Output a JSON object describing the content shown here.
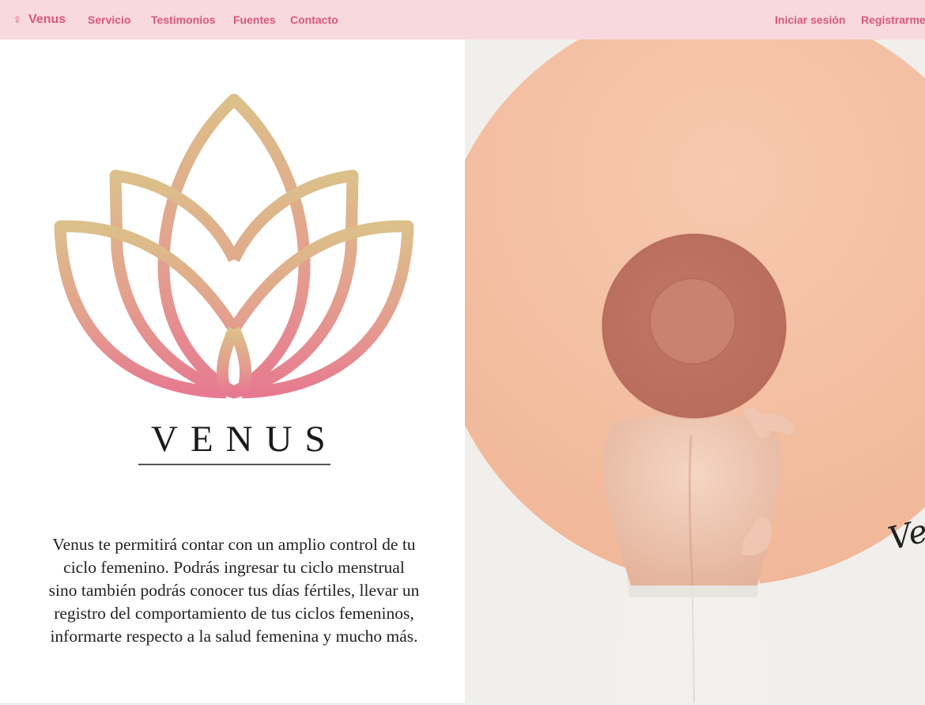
{
  "navbar": {
    "brand_icon": "♀",
    "brand_label": "Venus",
    "links": [
      {
        "label": "Servicio"
      },
      {
        "label": "Testimonios"
      },
      {
        "label": "Fuentes"
      },
      {
        "label": "Contacto"
      }
    ],
    "login_label": "Iniciar sesión",
    "register_label": "Registrarme"
  },
  "hero": {
    "logo_wordmark": "VENUS",
    "description": "Venus te permitirá contar con un amplio control de tu ciclo femenino. Podrás ingresar tu ciclo menstrual sino también podrás conocer tus días fértiles, llevar un registro del comportamiento de tus ciclos femeninos, informarte respecto a la salud femenina y mucho más.",
    "photo_signature": "Ve"
  },
  "colors": {
    "navbar_bg": "#f8d9dd",
    "accent": "#d9577f",
    "logo_gradient_top": "#dcc08a",
    "logo_gradient_bottom": "#e77a91",
    "photo_circle": "#f5c1a5",
    "photo_hat": "#c77e6b"
  },
  "icons": {
    "brand": "venus-symbol-icon",
    "logo": "lotus-logo-icon"
  }
}
